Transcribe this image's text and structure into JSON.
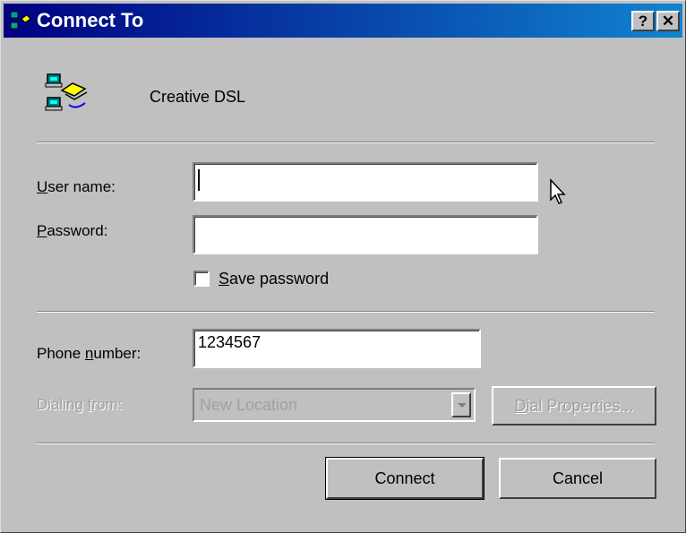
{
  "window": {
    "title": "Connect To",
    "help_button": "?",
    "close_button": "✕"
  },
  "connection": {
    "name": "Creative DSL",
    "icon": "dial-up-networking-icon"
  },
  "form": {
    "user_name": {
      "label_mnemonic": "U",
      "label_rest": "ser name:",
      "value": ""
    },
    "password": {
      "label_mnemonic": "P",
      "label_rest": "assword:",
      "value": ""
    },
    "save_password": {
      "label_mnemonic": "S",
      "label_rest": "ave password",
      "checked": false
    },
    "phone_number": {
      "label_before": "Phone ",
      "label_mnemonic": "n",
      "label_rest": "umber:",
      "value": "1234567"
    },
    "dialing_from": {
      "label_before": "Dialing ",
      "label_mnemonic": "f",
      "label_rest": "rom:",
      "value": "New Location",
      "enabled": false
    }
  },
  "buttons": {
    "dial_properties": {
      "label_mnemonic": "D",
      "label_rest": "ial Properties...",
      "enabled": false
    },
    "connect": "Connect",
    "cancel": "Cancel"
  },
  "colors": {
    "titlebar_start": "#000080",
    "titlebar_end": "#1084d0",
    "face": "#c0c0c0"
  }
}
